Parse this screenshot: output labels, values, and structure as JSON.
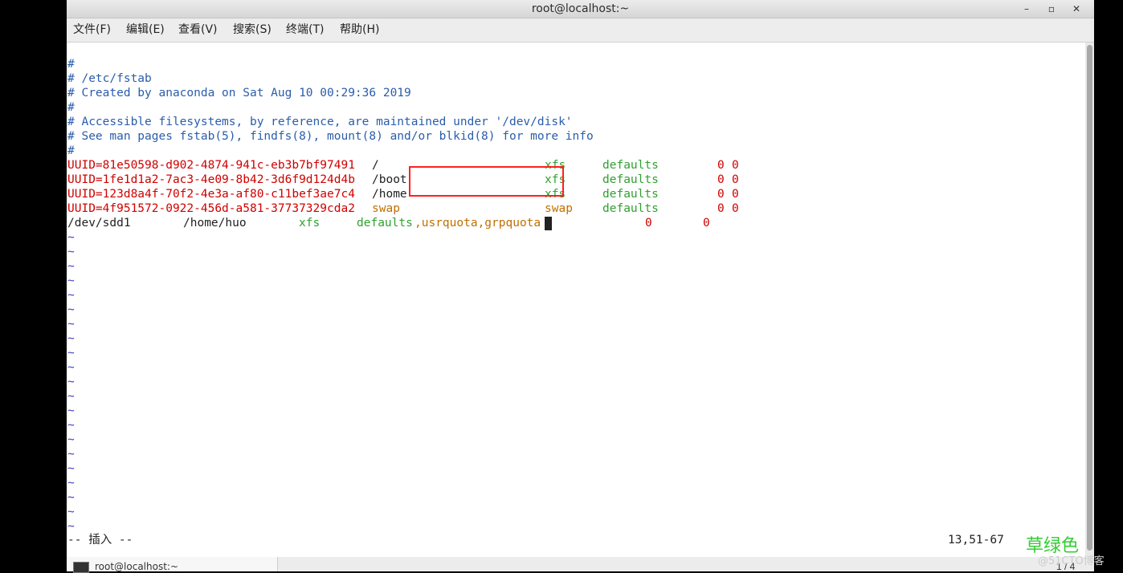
{
  "window": {
    "title": "root@localhost:~",
    "controls": {
      "minimize": "–",
      "maximize": "▫",
      "close": "✕"
    }
  },
  "menu": [
    "文件(F)",
    "编辑(E)",
    "查看(V)",
    "搜索(S)",
    "终端(T)",
    "帮助(H)"
  ],
  "editor": {
    "comments": [
      "#",
      "# /etc/fstab",
      "# Created by anaconda on Sat Aug 10 00:29:36 2019",
      "#",
      "# Accessible filesystems, by reference, are maintained under '/dev/disk'",
      "# See man pages fstab(5), findfs(8), mount(8) and/or blkid(8) for more info",
      "#"
    ],
    "entries": [
      {
        "device": "UUID=81e50598-d902-4874-941c-eb3b7bf97491",
        "mount": "/",
        "type": "xfs",
        "options": "defaults",
        "dump": "0",
        "pass": "0"
      },
      {
        "device": "UUID=1fe1d1a2-7ac3-4e09-8b42-3d6f9d124d4b",
        "mount": "/boot",
        "type": "xfs",
        "options": "defaults",
        "dump": "0",
        "pass": "0"
      },
      {
        "device": "UUID=123d8a4f-70f2-4e3a-af80-c11bef3ae7c4",
        "mount": "/home",
        "type": "xfs",
        "options": "defaults",
        "dump": "0",
        "pass": "0"
      },
      {
        "device": "UUID=4f951572-0922-456d-a581-37737329cda2",
        "mount": "swap",
        "type": "swap",
        "options": "defaults",
        "dump": "0",
        "pass": "0"
      }
    ],
    "new_entry": {
      "device": "/dev/sdd1",
      "mount": "/home/huo",
      "type": "xfs",
      "options_base": "defaults",
      "options_added": ",usrquota,grpquota",
      "dump": "0",
      "pass": "0"
    },
    "tilde": "~",
    "mode": "-- 插入 --",
    "position": "13,51-67"
  },
  "watermark": {
    "text": "草绿色",
    "site": "@51CTO博客"
  },
  "taskbar": {
    "item_label": "root@localhost:~",
    "page": "1 / 4"
  },
  "colors": {
    "comment": "#2a5daa",
    "uuid": "#d00000",
    "keyword": "#30a030",
    "highlight_border": "#ff2020"
  }
}
